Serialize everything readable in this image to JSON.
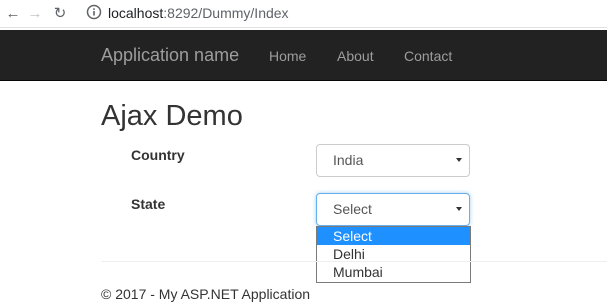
{
  "browser": {
    "url_host": "localhost",
    "url_rest": ":8292/Dummy/Index"
  },
  "navbar": {
    "brand": "Application name",
    "links": [
      "Home",
      "About",
      "Contact"
    ]
  },
  "main": {
    "title": "Ajax Demo",
    "country": {
      "label": "Country",
      "value": "India"
    },
    "state": {
      "label": "State",
      "value": "Select",
      "options": [
        "Select",
        "Delhi",
        "Mumbai"
      ],
      "highlighted_option": "Select"
    }
  },
  "footer": {
    "text": "© 2017 - My ASP.NET Application"
  },
  "colors": {
    "navbar_bg": "#222222",
    "nav_text": "#9d9d9d",
    "focus_border": "#66afe9",
    "option_highlight": "#1e90ff"
  }
}
